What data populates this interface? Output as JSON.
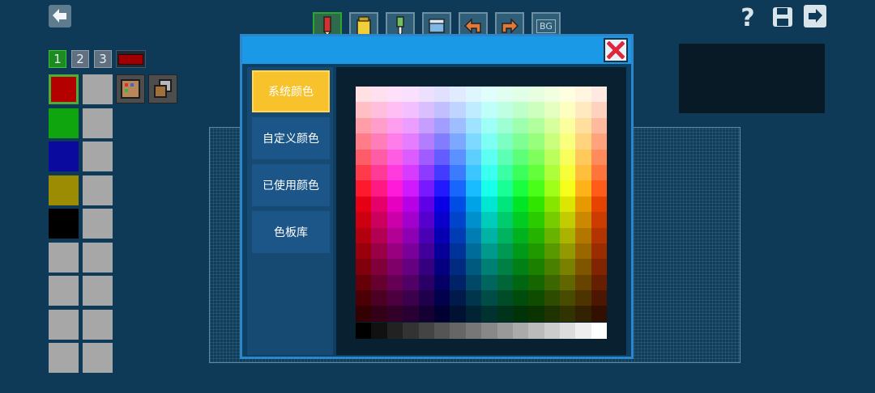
{
  "toolbar": {
    "tools": [
      "pencil-tool",
      "bucket-tool",
      "eyedropper-tool",
      "eraser-tool",
      "undo-tool",
      "redo-tool"
    ],
    "bg_label": "BG"
  },
  "top_right": {
    "help_label": "?"
  },
  "layers": {
    "tabs": [
      "1",
      "2",
      "3"
    ],
    "active": 0,
    "current_color": "#a00000"
  },
  "swatches": {
    "colors": [
      "#b50000",
      "#0ea50e",
      "#0a0a9e",
      "#9b8c04",
      "#000000",
      "#a7a7a7",
      "#a7a7a7",
      "#a7a7a7",
      "#a7a7a7"
    ],
    "second_column_color": "#a7a7a7"
  },
  "dialog": {
    "menu": [
      "系统颜色",
      "自定义颜色",
      "已使用颜色",
      "色板库"
    ],
    "active_menu": 0
  },
  "colors": {
    "background": "#0e3a58",
    "dialog_header": "#1a9ae6",
    "menu_active": "#f7c22b",
    "close_icon": "#e0263b"
  }
}
